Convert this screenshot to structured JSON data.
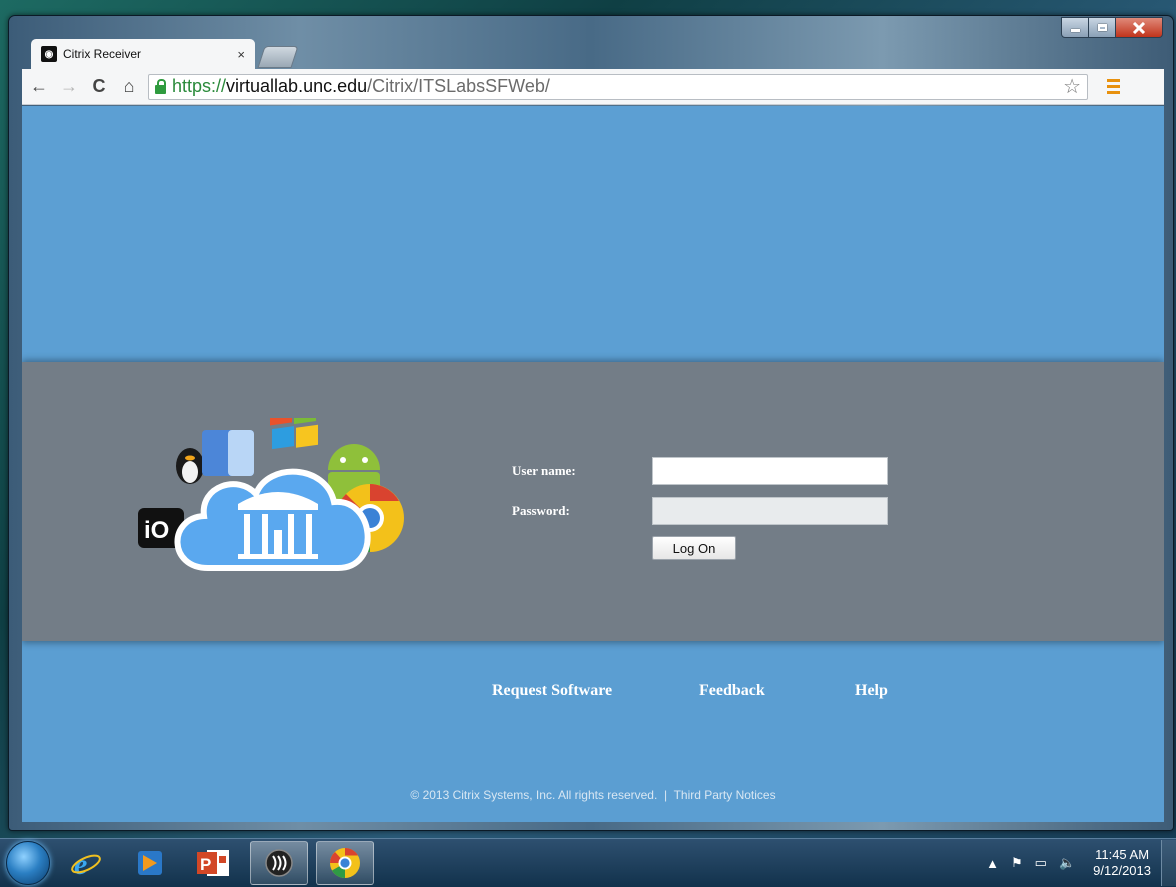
{
  "browser": {
    "tab_title": "Citrix Receiver",
    "tab_close": "×",
    "url_scheme": "https://",
    "url_host": "virtuallab.unc.edu",
    "url_path": "/Citrix/ITSLabsSFWeb/",
    "back": "←",
    "forward": "→",
    "reload": "C",
    "home": "⌂",
    "star": "☆"
  },
  "login": {
    "username_label": "User name:",
    "password_label": "Password:",
    "username_value": "",
    "password_value": "",
    "logon_button": "Log On"
  },
  "logo": {
    "ios_text": "iO"
  },
  "footer": {
    "links": [
      "Request Software",
      "Feedback",
      "Help"
    ],
    "copyright": "© 2013 Citrix Systems, Inc. All rights reserved.",
    "separator": "|",
    "third_party": "Third Party Notices"
  },
  "taskbar": {
    "time": "11:45 AM",
    "date": "9/12/2013",
    "tray_arrow": "▲",
    "tray_flag": "⚑",
    "tray_network": "▭",
    "tray_volume": "🔈"
  },
  "colors": {
    "page_blue": "#5c9fd3",
    "band_gray": "#737d87",
    "url_green": "#2a8a3a",
    "menu_orange": "#e8910e"
  }
}
